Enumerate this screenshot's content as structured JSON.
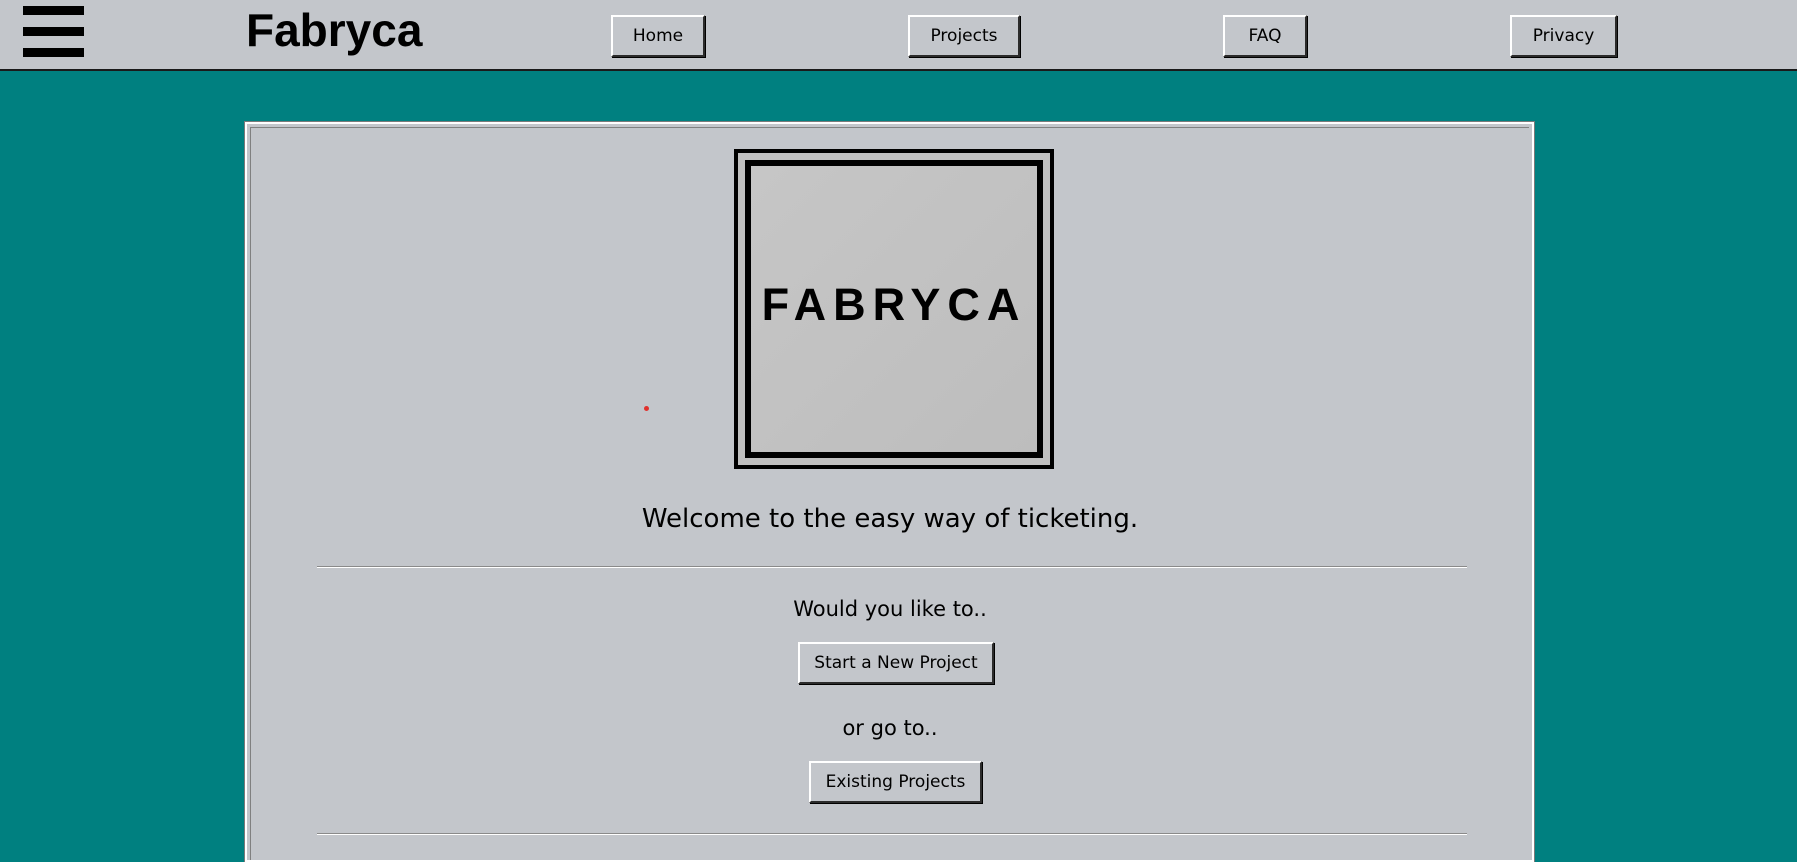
{
  "header": {
    "brand": "Fabryca",
    "menu_icon": "hamburger-menu-icon",
    "nav": [
      {
        "id": "home",
        "label": "Home"
      },
      {
        "id": "projects",
        "label": "Projects"
      },
      {
        "id": "faq",
        "label": "FAQ"
      },
      {
        "id": "privacy",
        "label": "Privacy"
      }
    ]
  },
  "main": {
    "logo_text": "FABRYCA",
    "welcome": "Welcome to the easy way of ticketing.",
    "prompt_1": "Would you like to..",
    "new_project_label": "Start a New Project",
    "prompt_2": "or go to..",
    "existing_projects_label": "Existing Projects"
  },
  "colors": {
    "background": "#008080",
    "surface": "#c3c6cb",
    "text": "#000000",
    "cursor_dot": "#e0312d"
  }
}
